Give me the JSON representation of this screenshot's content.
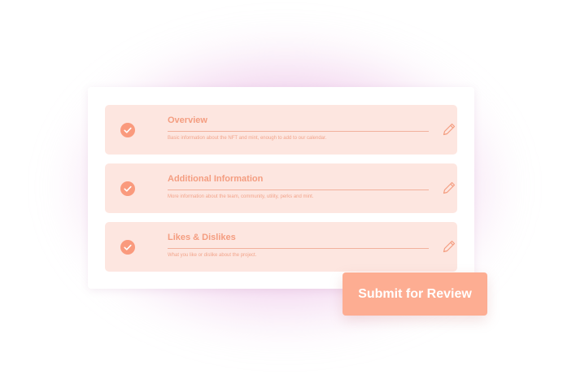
{
  "sections": [
    {
      "title": "Overview",
      "description": "Basic information about the NFT and mint, enough to add to our calendar.",
      "status_icon": "check-circle-icon",
      "action_icon": "pencil-icon"
    },
    {
      "title": "Additional Information",
      "description": "More information about the team, community, utility, perks and mint.",
      "status_icon": "check-circle-icon",
      "action_icon": "pencil-icon"
    },
    {
      "title": "Likes & Dislikes",
      "description": "What you like or dislike about the project.",
      "status_icon": "check-circle-icon",
      "action_icon": "pencil-icon"
    }
  ],
  "submit_label": "Submit for Review",
  "colors": {
    "accent": "#fa9a7d",
    "section_bg": "#fde6e0",
    "button_bg": "#fdad92",
    "glow": "#d478c8"
  }
}
